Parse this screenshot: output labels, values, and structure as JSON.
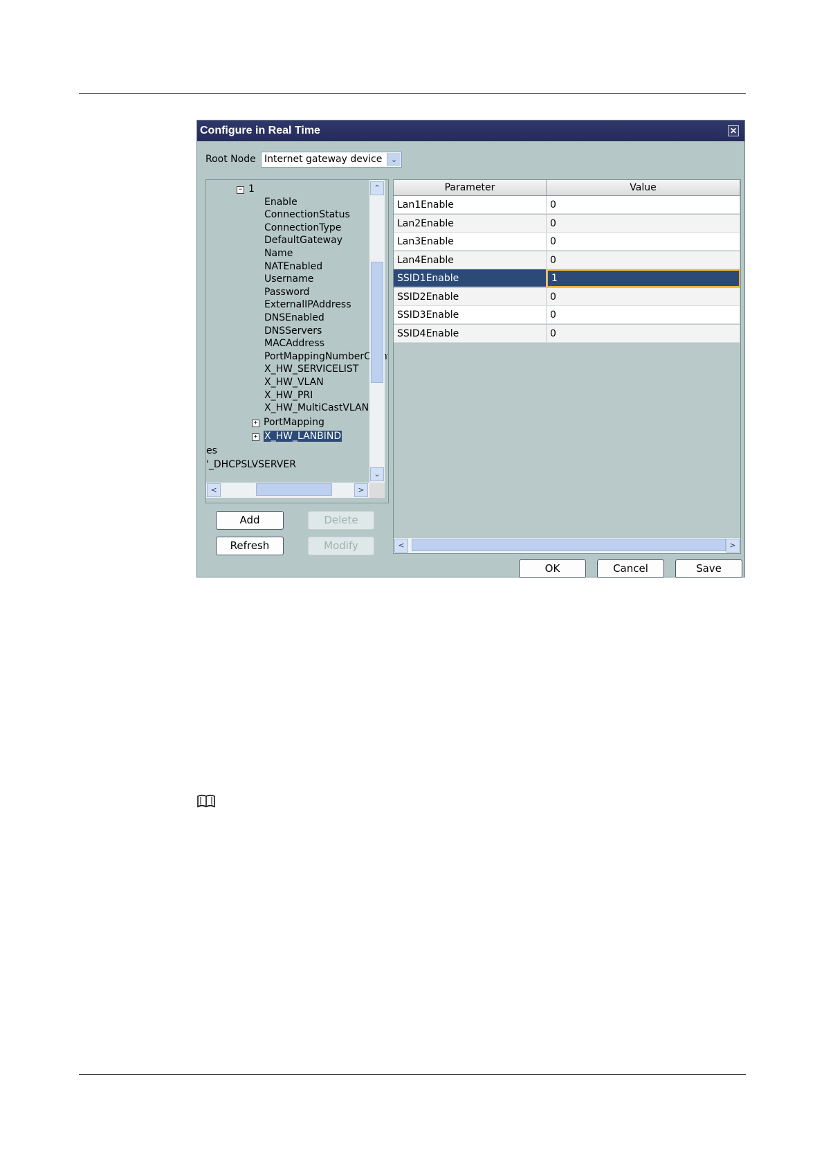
{
  "dialog": {
    "title": "Configure in Real Time",
    "close_glyph": "✕",
    "root_node_label": "Root Node",
    "root_node_value": "Internet gateway device",
    "dropdown_glyph": "⌄"
  },
  "tree": {
    "items": [
      {
        "label": "1",
        "toggle": "−"
      },
      {
        "label": "Enable"
      },
      {
        "label": "ConnectionStatus"
      },
      {
        "label": "ConnectionType"
      },
      {
        "label": "DefaultGateway"
      },
      {
        "label": "Name"
      },
      {
        "label": "NATEnabled"
      },
      {
        "label": "Username"
      },
      {
        "label": "Password"
      },
      {
        "label": "ExternalIPAddress"
      },
      {
        "label": "DNSEnabled"
      },
      {
        "label": "DNSServers"
      },
      {
        "label": "MACAddress"
      },
      {
        "label": "PortMappingNumberOfEntries"
      },
      {
        "label": "X_HW_SERVICELIST"
      },
      {
        "label": "X_HW_VLAN"
      },
      {
        "label": "X_HW_PRI"
      },
      {
        "label": "X_HW_MultiCastVLAN"
      },
      {
        "label": "PortMapping",
        "toggle": "+"
      },
      {
        "label": "X_HW_LANBIND",
        "toggle": "+",
        "selected": true
      },
      {
        "label": "es"
      },
      {
        "label": "'_DHCPSLVSERVER"
      }
    ]
  },
  "scroll": {
    "up": "⌃",
    "down": "⌄",
    "left": "<",
    "right": ">",
    "grip": "⦀"
  },
  "buttons": {
    "add": "Add",
    "delete": "Delete",
    "refresh": "Refresh",
    "modify": "Modify",
    "ok": "OK",
    "cancel": "Cancel",
    "save": "Save"
  },
  "grid": {
    "headers": [
      "Parameter",
      "Value"
    ],
    "rows": [
      {
        "parameter": "Lan1Enable",
        "value": "0"
      },
      {
        "parameter": "Lan2Enable",
        "value": "0"
      },
      {
        "parameter": "Lan3Enable",
        "value": "0"
      },
      {
        "parameter": "Lan4Enable",
        "value": "0"
      },
      {
        "parameter": "SSID1Enable",
        "value": "1",
        "selected": true
      },
      {
        "parameter": "SSID2Enable",
        "value": "0"
      },
      {
        "parameter": "SSID3Enable",
        "value": "0"
      },
      {
        "parameter": "SSID4Enable",
        "value": "0"
      }
    ]
  },
  "note_icon": "book-icon",
  "colors": {
    "title_bar": "#252c5c",
    "dialog_bg": "#b6c7c7",
    "selection": "#2b4a78",
    "focus_border": "#f2b33d"
  }
}
